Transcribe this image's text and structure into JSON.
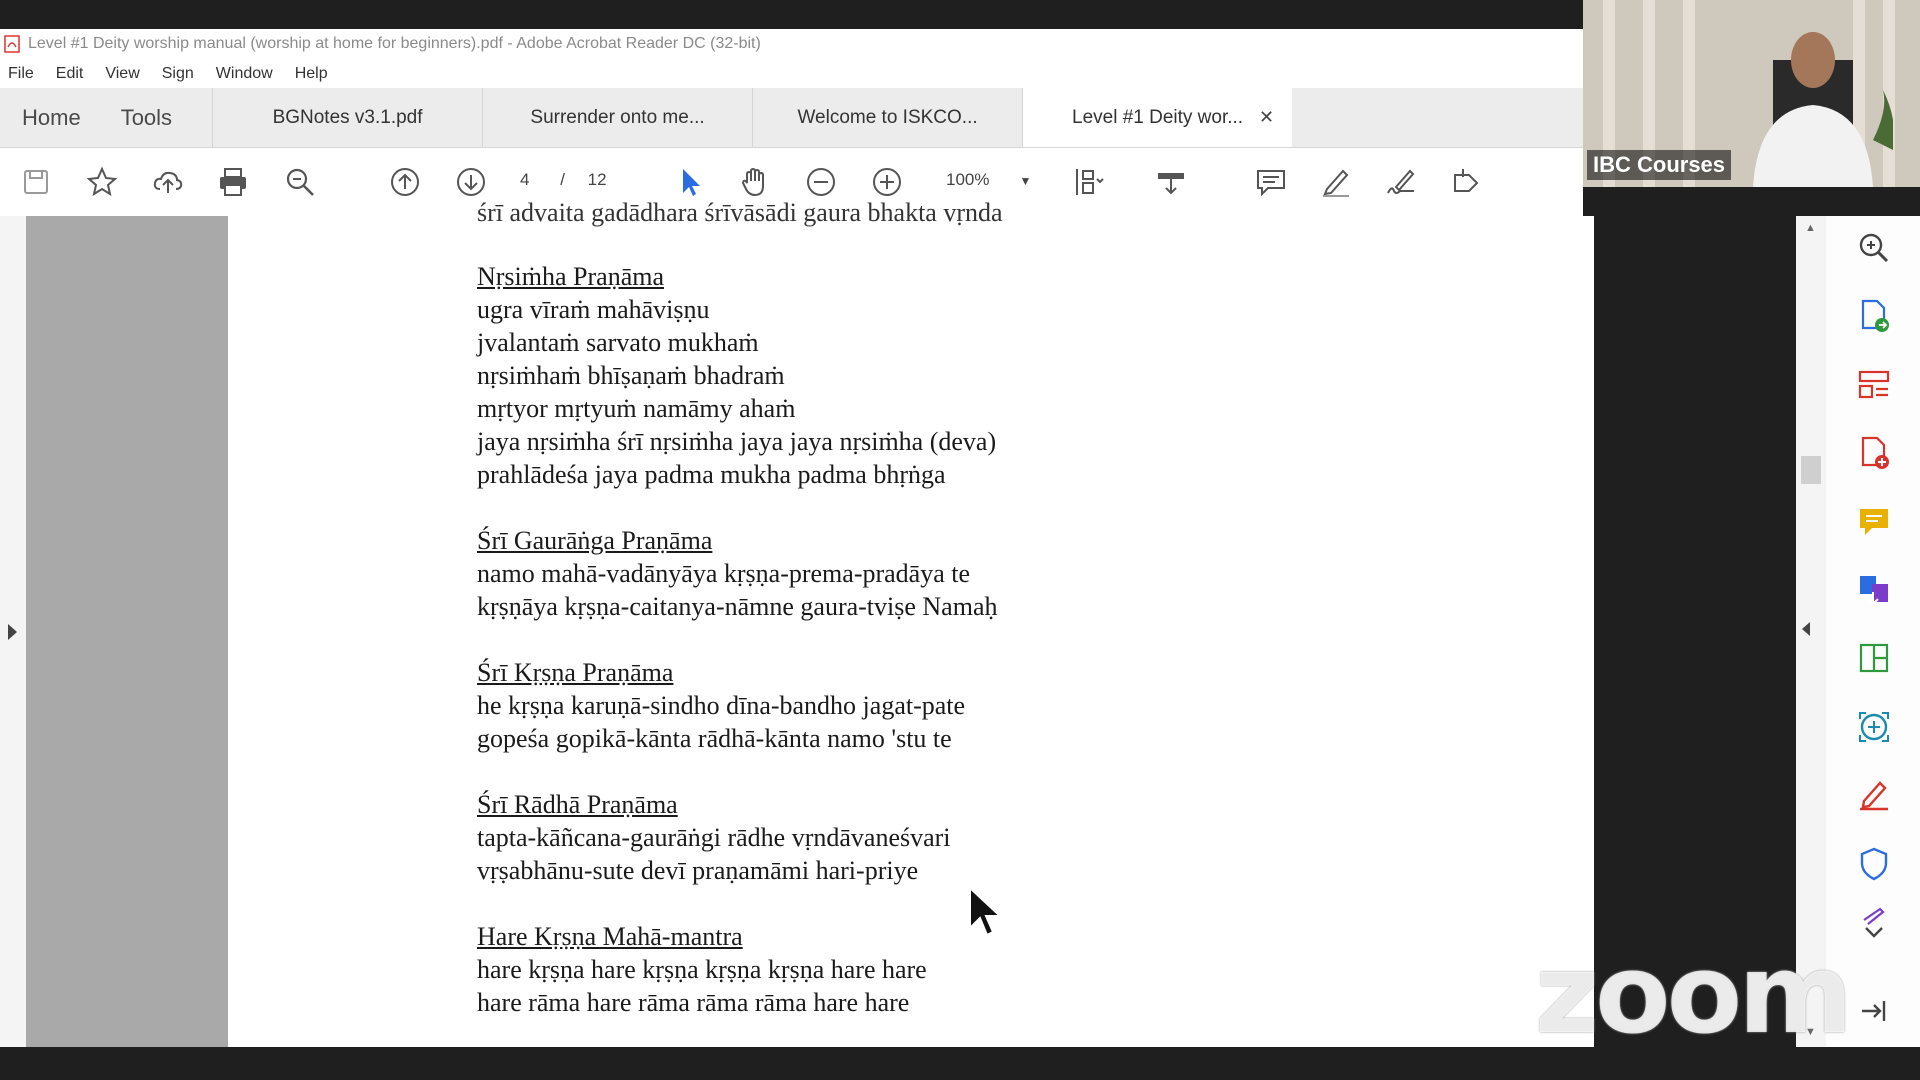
{
  "window": {
    "title": "Level #1 Deity worship manual (worship at home for beginners).pdf - Adobe Acrobat Reader DC (32-bit)"
  },
  "menu": [
    "File",
    "Edit",
    "View",
    "Sign",
    "Window",
    "Help"
  ],
  "nav_tabs": [
    "Home",
    "Tools"
  ],
  "doc_tabs": [
    {
      "label": "BGNotes v3.1.pdf",
      "active": false
    },
    {
      "label": "Surrender onto me...",
      "active": false
    },
    {
      "label": "Welcome to  ISKCO...",
      "active": false
    },
    {
      "label": "Level #1 Deity wor...",
      "active": true
    }
  ],
  "toolbar": {
    "page_current": "4",
    "page_sep": "/",
    "page_total": "12",
    "zoom": "100%",
    "icons": [
      "save-icon",
      "bookmark-star-icon",
      "upload-cloud-icon",
      "print-icon",
      "zoom-out-magnifier-icon",
      "page-up-icon",
      "page-down-icon",
      "select-cursor-icon",
      "hand-tool-icon",
      "zoom-out-icon",
      "zoom-in-icon",
      "zoom-dropdown-icon",
      "fit-page-icon",
      "scroll-mode-icon",
      "comment-icon",
      "highlight-pen-icon",
      "sign-icon",
      "share-icon"
    ]
  },
  "document": {
    "cut_line": "śrī advaita gadādhara śrīvāsādi gaura bhakta vṛnda",
    "sections": [
      {
        "heading": "Nṛsiṁha Praṇāma",
        "lines": [
          "ugra vīraṁ mahāviṣṇu",
          "jvalantaṁ sarvato mukhaṁ",
          "nṛsiṁhaṁ bhīṣaṇaṁ bhadraṁ",
          "mṛtyor mṛtyuṁ namāmy ahaṁ",
          "jaya nṛsiṁha śrī nṛsiṁha jaya jaya nṛsiṁha (deva)",
          "prahlādeśa jaya padma mukha padma bhṛṅga"
        ]
      },
      {
        "heading": "Śrī Gaurāṅga Praṇāma",
        "lines": [
          "namo mahā-vadānyāya kṛṣṇa-prema-pradāya te",
          "kṛṣṇāya kṛṣṇa-caitanya-nāmne gaura-tviṣe Namaḥ"
        ]
      },
      {
        "heading": "Śrī Kṛṣṇa Praṇāma",
        "lines": [
          "he kṛṣṇa karuṇā-sindho dīna-bandho jagat-pate",
          "gopeśa gopikā-kānta rādhā-kānta namo 'stu te"
        ]
      },
      {
        "heading": "Śrī Rādhā Praṇāma",
        "lines": [
          "tapta-kāñcana-gaurāṅgi rādhe vṛndāvaneśvari",
          "vṛṣabhānu-sute devī praṇamāmi hari-priye"
        ]
      },
      {
        "heading": "Hare Kṛṣṇa Mahā-mantra",
        "lines": [
          "hare kṛṣṇa hare kṛṣṇa kṛṣṇa kṛṣṇa hare hare",
          "hare rāma hare rāma rāma rāma hare hare"
        ]
      }
    ]
  },
  "right_tools": [
    "search-zoom-icon",
    "export-pdf-icon",
    "organize-pages-icon",
    "create-pdf-icon",
    "comment-icon",
    "combine-files-icon",
    "edit-pdf-icon",
    "scan-ocr-icon",
    "fill-sign-icon",
    "protect-icon",
    "more-tools-chevron-icon",
    "collapse-panel-icon"
  ],
  "video": {
    "participant_label": "IBC Courses"
  },
  "overlay": {
    "zoom_watermark": "zoom"
  },
  "colors": {
    "accent_blue": "#2b6de0",
    "tool_red": "#d9342b",
    "tool_green": "#2e9a3d",
    "tool_yellow": "#e8b100",
    "tool_purple": "#7a3cc9"
  }
}
